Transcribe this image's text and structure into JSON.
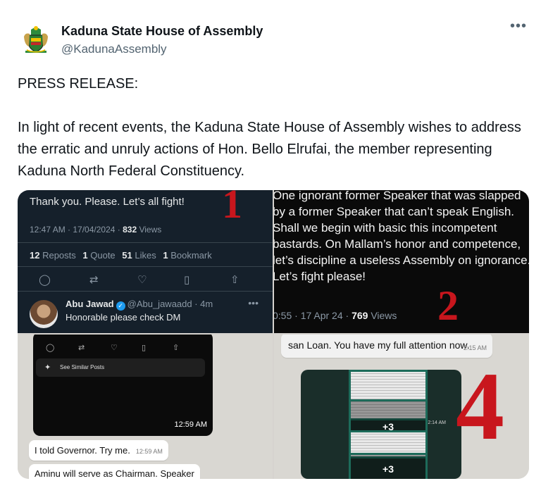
{
  "tweet": {
    "author_name": "Kaduna State House of Assembly",
    "author_handle": "@KadunaAssembly",
    "more_icon": "more-horizontal-icon",
    "text_title": "PRESS RELEASE:",
    "text_body": "In light of recent events, the Kaduna State House of Assembly wishes to address the erratic and unruly actions of Hon. Bello Elrufai, the member representing Kaduna North Federal Constituency."
  },
  "images": {
    "image1": {
      "marker": "1",
      "quote_text": "Thank you. Please. Let’s all fight!",
      "timestamp": "12:47 AM · 17/04/2024 · ",
      "views_count": "832",
      "views_label": " Views",
      "reposts_count": "12",
      "reposts_label": " Reposts",
      "quotes_count": "1",
      "quotes_label": " Quote",
      "likes_count": "51",
      "likes_label": " Likes",
      "bookmarks_count": "1",
      "bookmarks_label": " Bookmark",
      "reply_name": "Abu Jawad",
      "reply_handle": "@Abu_jawaadd · 4m",
      "reply_text": "Honorable please check DM"
    },
    "image2": {
      "marker": "2",
      "body": "One ignorant former Speaker that was slapped by a former Speaker that can’t speak English. Shall we begin with basic this incompetent bastards. On Mallam’s honor and competence, let’s discipline a useless Assembly on ignorance. Let’s fight please!",
      "timestamp": "0:55 · 17 Apr 24 · ",
      "views_count": "769",
      "views_label": " Views"
    },
    "image3": {
      "similar_label": "See Similar Posts",
      "time_phone": "12:59 AM",
      "msg1": "I told Governor. Try me.",
      "msg1_time": "12:59 AM",
      "msg2": "Aminu will serve as Chairman. Speaker"
    },
    "image4": {
      "marker": "4",
      "msg": "san Loan. You have my full attention now.",
      "msg_time": "2:15 AM",
      "plus1": "+3",
      "plus2": "+3",
      "album_time": "2:14 AM"
    }
  }
}
